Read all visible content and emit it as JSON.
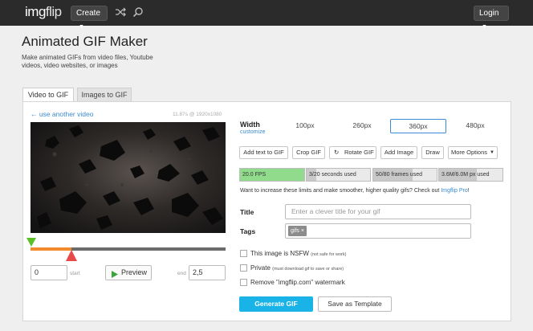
{
  "header": {
    "logo_part1": "img",
    "logo_part2": "flip",
    "create_label": "Create",
    "shuffle_icon": "shuffle-icon",
    "search_icon": "search-icon",
    "login_label": "Login"
  },
  "page": {
    "title": "Animated GIF Maker",
    "subtitle": "Make animated GIFs from video files, Youtube videos, video websites, or images"
  },
  "tabs": [
    {
      "label": "Video to GIF",
      "active": true
    },
    {
      "label": "Images to GIF",
      "active": false
    }
  ],
  "video": {
    "use_another": "← use another video",
    "info": "11.87s @ 1920x1080",
    "start_value": "0",
    "start_label": "start",
    "end_value": "2,5",
    "end_label": "end",
    "preview_label": "Preview",
    "selection_fraction": 0.21
  },
  "width": {
    "label": "Width",
    "customize": "customize",
    "options": [
      "100px",
      "260px",
      "360px",
      "480px"
    ],
    "selected": "360px"
  },
  "tools": [
    "Add text to GIF",
    "Crop GIF",
    "Rotate GIF",
    "Add Image",
    "Draw",
    "More Options"
  ],
  "meters": [
    {
      "text": "20.0 FPS",
      "fill": 1.0,
      "color": "#90dc8c"
    },
    {
      "text": "3/20 seconds used",
      "fill": 0.15,
      "color": "#c9c9c9"
    },
    {
      "text": "50/80 frames used",
      "fill": 0.62,
      "color": "#c9c9c9"
    },
    {
      "text": "3.6M/6.0M px used",
      "fill": 0.6,
      "color": "#c9c9c9"
    }
  ],
  "upsell": {
    "text": "Want to increase these limits and make smoother, higher quality gifs? Check out ",
    "link": "Imgflip Pro",
    "end": "!"
  },
  "form": {
    "title_label": "Title",
    "title_placeholder": "Enter a clever title for your gif",
    "tags_label": "Tags",
    "tag_chip": "gifs ×"
  },
  "options": [
    {
      "label": "This image is NSFW",
      "note": "(not safe for work)"
    },
    {
      "label": "Private",
      "note": "(must download gif to save or share)"
    },
    {
      "label": "Remove \"imgflip.com\" watermark",
      "note": ""
    }
  ],
  "actions": {
    "generate": "Generate GIF",
    "save_template": "Save as Template"
  },
  "colors": {
    "topbar": "#2b2b2b",
    "accent_blue": "#1ab3e8",
    "link_blue": "#3b8cd4",
    "progress_orange": "#f08a2c",
    "start_marker_green": "#5cbf2a",
    "end_marker_red": "#e84a4a"
  }
}
